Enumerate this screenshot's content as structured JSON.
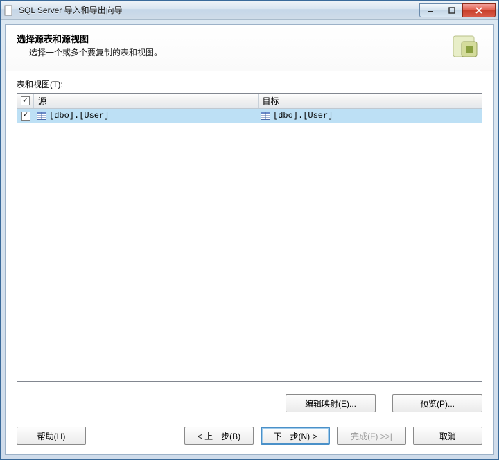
{
  "window": {
    "title": "SQL Server 导入和导出向导"
  },
  "header": {
    "title": "选择源表和源视图",
    "subtitle": "选择一个或多个要复制的表和视图。"
  },
  "table": {
    "label": "表和视图(T):",
    "columns": {
      "source": "源",
      "target": "目标"
    },
    "rows": [
      {
        "checked": true,
        "source": "[dbo].[User]",
        "target": "[dbo].[User]"
      }
    ],
    "headerChecked": true
  },
  "midButtons": {
    "editMapping": "编辑映射(E)...",
    "preview": "预览(P)..."
  },
  "footer": {
    "help": "帮助(H)",
    "back": "< 上一步(B)",
    "next": "下一步(N) >",
    "finish": "完成(F) >>|",
    "cancel": "取消"
  }
}
